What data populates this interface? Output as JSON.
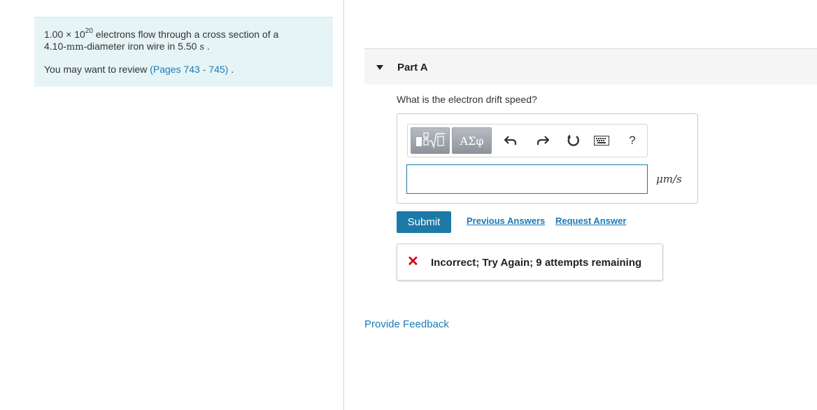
{
  "problem": {
    "coefficient": "1.00",
    "times": "×",
    "base": "10",
    "exponent": "20",
    "line1_rest": "electrons flow through a cross section of a",
    "diameter_value": "4.10-",
    "diameter_unit": "mm",
    "line2_mid": "-diameter iron wire in 5.50",
    "time_unit": "s",
    "line2_end": ".",
    "review_prefix": "You may want to review",
    "review_link": "(Pages 743 - 745)",
    "review_suffix": "."
  },
  "part": {
    "title": "Part A",
    "question": "What is the electron drift speed?"
  },
  "toolbar": {
    "greek_label": "ΑΣφ",
    "help_label": "?"
  },
  "answer": {
    "value": "",
    "units": "μm/s"
  },
  "actions": {
    "submit": "Submit",
    "previous_answers": "Previous Answers",
    "request_answer": "Request Answer"
  },
  "feedback": {
    "status_icon": "x-icon",
    "message": "Incorrect; Try Again; 9 attempts remaining",
    "icon_color": "#d0021b"
  },
  "footer": {
    "provide_feedback": "Provide Feedback"
  },
  "colors": {
    "accent": "#1c7aa6",
    "link": "#1a7bb9",
    "problem_bg": "#e6f4f6"
  }
}
